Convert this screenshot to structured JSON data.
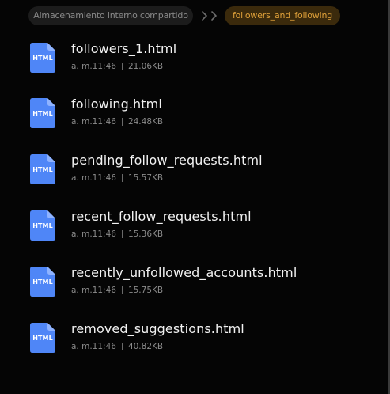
{
  "breadcrumb": {
    "root_label": "Almacenamiento interno compartido",
    "current_label": "followers_and_following"
  },
  "colors": {
    "background": "#050505",
    "accent": "#e0a13a",
    "accent_bg": "#3b2a0c",
    "file_icon_blue": "#4f86f7"
  },
  "icons": {
    "file_type": "html-file-icon",
    "separator": "chevron-right-icon"
  },
  "files": [
    {
      "name": "followers_1.html",
      "time": "a. m.11:46",
      "size": "21.06KB",
      "type": "HTML"
    },
    {
      "name": "following.html",
      "time": "a. m.11:46",
      "size": "24.48KB",
      "type": "HTML"
    },
    {
      "name": "pending_follow_requests.html",
      "time": "a. m.11:46",
      "size": "15.57KB",
      "type": "HTML"
    },
    {
      "name": "recent_follow_requests.html",
      "time": "a. m.11:46",
      "size": "15.36KB",
      "type": "HTML"
    },
    {
      "name": "recently_unfollowed_accounts.html",
      "time": "a. m.11:46",
      "size": "15.75KB",
      "type": "HTML"
    },
    {
      "name": "removed_suggestions.html",
      "time": "a. m.11:46",
      "size": "40.82KB",
      "type": "HTML"
    }
  ]
}
